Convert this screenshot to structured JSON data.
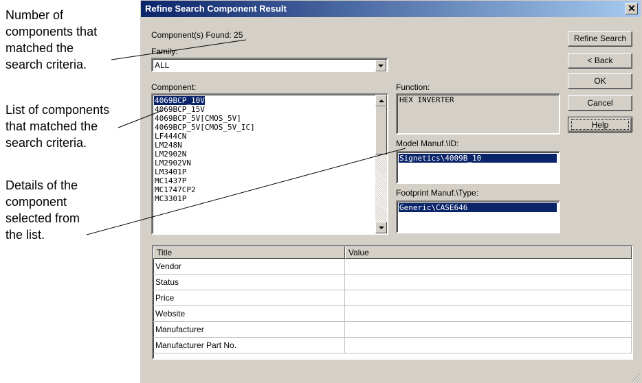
{
  "annotations": {
    "count": [
      "Number of",
      "components that",
      "matched the",
      "search criteria."
    ],
    "list": [
      "List of components",
      "that matched the",
      "search criteria."
    ],
    "details": [
      "Details of the",
      "component",
      "selected from",
      "the list."
    ]
  },
  "dialog": {
    "title": "Refine Search Component Result",
    "close_glyph": "✕",
    "found_label": "Component(s) Found: 25",
    "family_label": "Family:",
    "family_value": "ALL",
    "component_label": "Component:",
    "components": [
      "4069BCP_10V",
      "4069BCP_15V",
      "4069BCP_5V[CMOS_5V]",
      "4069BCP_5V[CMOS_5V_IC]",
      "LF444CN",
      "LM248N",
      "LM2902N",
      "LM2902VN",
      "LM3401P",
      "MC1437P",
      "MC1747CP2",
      "MC3301P"
    ],
    "selected_component": "4069BCP_10V",
    "function_label": "Function:",
    "function_value": "HEX INVERTER",
    "model_label": "Model Manuf.\\ID:",
    "model_value": "Signetics\\4009B_10",
    "footprint_label": "Footprint Manuf.\\Type:",
    "footprint_value": "Generic\\CASE646",
    "buttons": {
      "refine": "Refine Search",
      "back": "< Back",
      "ok": "OK",
      "cancel": "Cancel",
      "help": "Help"
    },
    "table": {
      "headers": [
        "Title",
        "Value"
      ],
      "rows": [
        [
          "Vendor",
          ""
        ],
        [
          "Status",
          ""
        ],
        [
          "Price",
          ""
        ],
        [
          "Website",
          ""
        ],
        [
          "Manufacturer",
          ""
        ],
        [
          "Manufacturer Part No.",
          ""
        ]
      ]
    }
  },
  "colors": {
    "selection": "#0a246a",
    "face": "#d4d0c8",
    "title_start": "#0a246a",
    "title_end": "#a6caf0"
  }
}
